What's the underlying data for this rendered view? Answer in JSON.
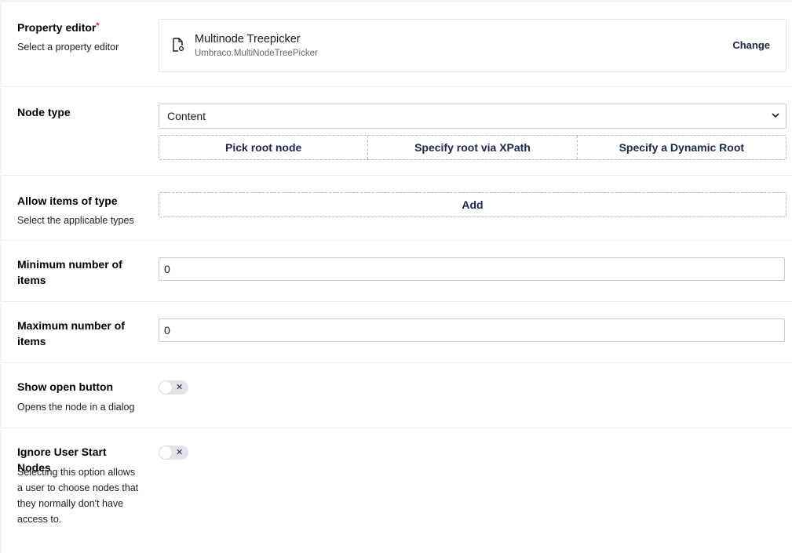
{
  "property_editor": {
    "label": "Property editor",
    "required_mark": "*",
    "description": "Select a property editor",
    "editor_name": "Multinode Treepicker",
    "editor_alias": "Umbraco.MultiNodeTreePicker",
    "change_label": "Change",
    "icon": "document-icon"
  },
  "node_type": {
    "label": "Node type",
    "selected": "Content",
    "options": [
      "Content"
    ],
    "buttons": [
      "Pick root node",
      "Specify root via XPath",
      "Specify a Dynamic Root"
    ]
  },
  "allow_items": {
    "label": "Allow items of type",
    "description": "Select the applicable types",
    "add_label": "Add"
  },
  "minimum_items": {
    "label": "Minimum number of items",
    "value": "0"
  },
  "maximum_items": {
    "label": "Maximum number of items",
    "value": "0"
  },
  "show_open_button": {
    "label": "Show open button",
    "description": "Opens the node in a dialog",
    "enabled": false,
    "toggle_glyph": "✕"
  },
  "ignore_user_start_nodes": {
    "label": "Ignore User Start Nodes",
    "description": "Selecting this option allows a user to choose nodes that they normally don't have access to.",
    "enabled": false,
    "toggle_glyph": "✕"
  },
  "colors": {
    "primary_text": "#1b264f",
    "required": "#d42054",
    "border": "#c9c9ce"
  }
}
